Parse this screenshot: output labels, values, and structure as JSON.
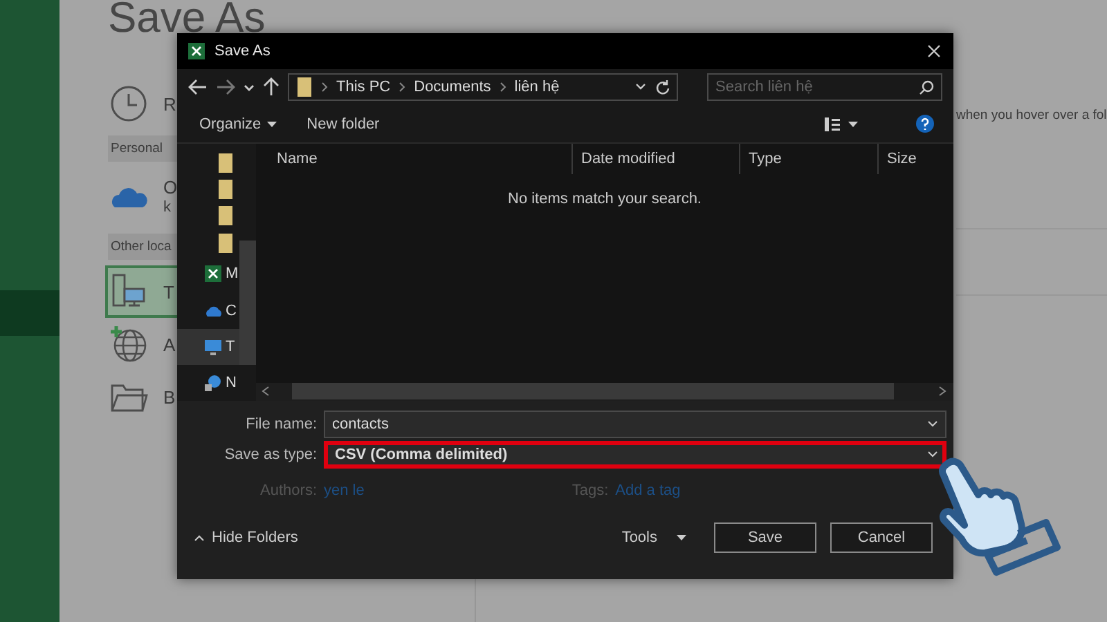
{
  "backstage": {
    "title": "Save As",
    "items": [
      {
        "kind": "item",
        "label": "R",
        "selected": false
      },
      {
        "kind": "header",
        "label": "Personal"
      },
      {
        "kind": "item",
        "label": "O",
        "sublabel": "k",
        "selected": false
      },
      {
        "kind": "header",
        "label": "Other loca"
      },
      {
        "kind": "item",
        "label": "T",
        "selected": true
      },
      {
        "kind": "item",
        "label": "A",
        "selected": false
      },
      {
        "kind": "item",
        "label": "B",
        "selected": false
      }
    ],
    "hint": "when you hover over a fol"
  },
  "dialog": {
    "title": "Save As",
    "address": [
      "This PC",
      "Documents",
      "liên hệ"
    ],
    "search": {
      "placeholder": "Search liên hệ"
    },
    "toolbar": {
      "organize": "Organize",
      "new_folder": "New folder"
    },
    "nav_pane": [
      {
        "kind": "folder"
      },
      {
        "kind": "folder"
      },
      {
        "kind": "folder"
      },
      {
        "kind": "folder"
      },
      {
        "kind": "location",
        "label": "M",
        "selected": false
      },
      {
        "kind": "location",
        "label": "C",
        "selected": false
      },
      {
        "kind": "location",
        "label": "T",
        "selected": true
      },
      {
        "kind": "location",
        "label": "N",
        "selected": false
      }
    ],
    "columns": [
      "Name",
      "Date modified",
      "Type",
      "Size"
    ],
    "empty_message": "No items match your search.",
    "file_name": {
      "label": "File name:",
      "value": "contacts"
    },
    "save_type": {
      "label": "Save as type:",
      "value": "CSV (Comma delimited)",
      "highlighted": true
    },
    "authors": {
      "label": "Authors:",
      "value": "yen le"
    },
    "tags": {
      "label": "Tags:",
      "value": "Add a tag"
    },
    "hide_folders": "Hide Folders",
    "tools": "Tools",
    "buttons": [
      "Save",
      "Cancel"
    ]
  }
}
